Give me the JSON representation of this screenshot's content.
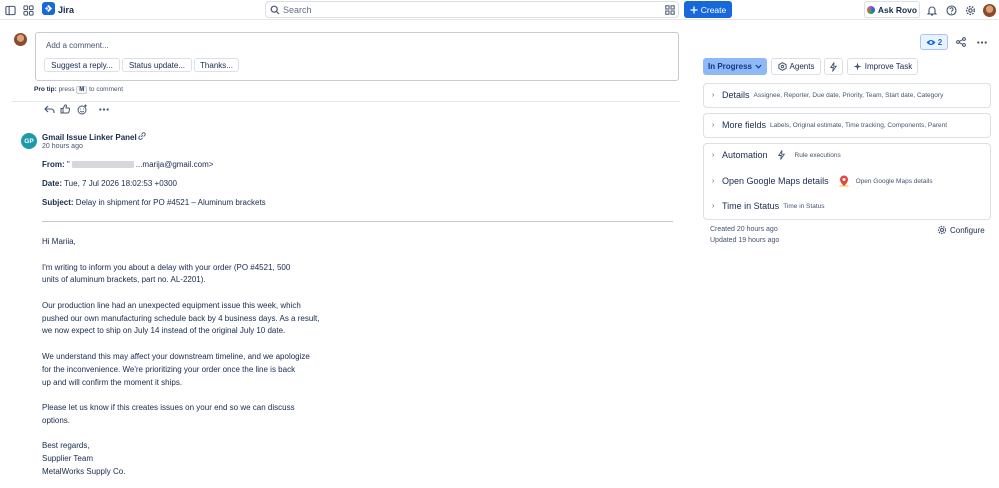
{
  "app": {
    "title": "Jira"
  },
  "search": {
    "placeholder": "Search"
  },
  "topbar": {
    "create_label": "Create",
    "rovo_label": "Ask Rovo"
  },
  "comment": {
    "placeholder": "Add a comment...",
    "suggestions": [
      "Suggest a reply...",
      "Status update...",
      "Thanks..."
    ],
    "protip_label": "Pro tip:",
    "protip_press": "press",
    "protip_key": "M",
    "protip_rest": "to comment"
  },
  "entry": {
    "avatar_initials": "GP",
    "author": "Gmail Issue Linker Panel",
    "time": "20 hours ago",
    "from_label": "From:",
    "from_value": "\"",
    "from_email": "...marija@gmail.com>",
    "date_label": "Date:",
    "date_value": "Tue, 7 Jul 2026 18:02:53 +0300",
    "subject_label": "Subject:",
    "subject_value": "Delay in shipment for PO #4521 – Aluminum brackets",
    "body": [
      "Hi Mariia,",
      "I'm writing to inform you about a delay with your order (PO #4521, 500",
      "units of aluminum brackets, part no. AL-2201).",
      "Our production line had an unexpected equipment issue this week, which",
      "pushed our own manufacturing schedule back by 4 business days. As a result,",
      "we now expect to ship on July 14 instead of the original July 10 date.",
      "We understand this may affect your downstream timeline, and we apologize",
      "for the inconvenience. We're prioritizing your order once the line is back",
      "up and will confirm the moment it ships.",
      "Please let us know if this creates issues on your end so we can discuss",
      "options.",
      "Best regards,",
      "Supplier Team",
      "MetalWorks Supply Co."
    ]
  },
  "panel": {
    "watch_count": "2",
    "status_label": "In Progress",
    "agents_label": "Agents",
    "improve_label": "Improve Task",
    "sections": [
      {
        "title": "Details",
        "subtitle": "Assignee, Reporter, Due date, Priority, Team, Start date, Category"
      },
      {
        "title": "More fields",
        "subtitle": "Labels, Original estimate, Time tracking, Components, Parent"
      },
      {
        "title": "Automation",
        "subtitle": "Rule executions"
      },
      {
        "title": "Open Google Maps details",
        "subtitle": "Open Google Maps details"
      },
      {
        "title": "Time in Status",
        "subtitle": "Time in Status"
      }
    ],
    "created": "Created 20 hours ago",
    "updated": "Updated 19 hours ago",
    "configure_label": "Configure"
  },
  "colors": {
    "accent": "#1868db",
    "status_bg": "#8fb8f6",
    "avatar_bot": "#1d9aaa"
  }
}
